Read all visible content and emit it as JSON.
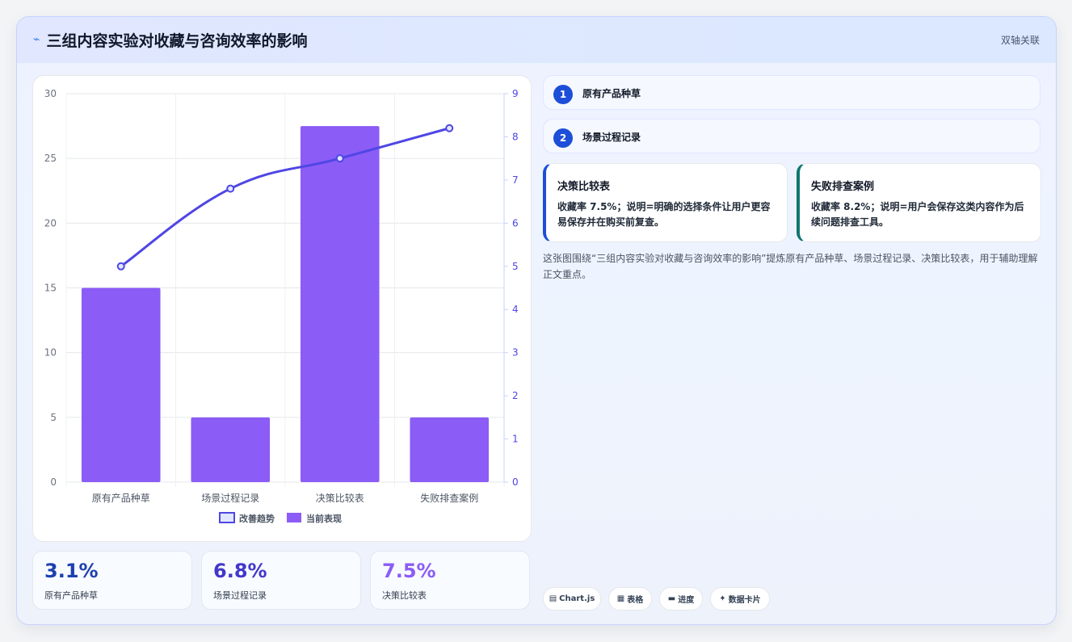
{
  "header": {
    "icon": "sparkline-icon",
    "title": "三组内容实验对收藏与咨询效率的影响",
    "badge": "双轴关联"
  },
  "chart_data": {
    "type": "bar",
    "categories": [
      "原有产品种草",
      "场景过程记录",
      "决策比较表",
      "失败排查案例"
    ],
    "series": [
      {
        "name": "当前表现",
        "type": "bar",
        "axis": "left",
        "values": [
          15,
          5,
          27.5,
          5
        ],
        "color": "#8b5cf6"
      },
      {
        "name": "改善趋势",
        "type": "line",
        "axis": "right",
        "values": [
          5,
          6.8,
          7.5,
          8.2
        ],
        "color": "#4f46e5"
      }
    ],
    "y_left": {
      "range": [
        0,
        30
      ],
      "ticks": [
        "0",
        "5",
        "10",
        "15",
        "20",
        "25",
        "30"
      ]
    },
    "y_right": {
      "range": [
        0,
        9
      ],
      "ticks": [
        "0",
        "1",
        "2",
        "3",
        "4",
        "5",
        "6",
        "7",
        "8",
        "9"
      ]
    },
    "grid": true,
    "legend": "bottom"
  },
  "kpis": [
    {
      "value": "3.1%",
      "label": "原有产品种草",
      "color": "#1e40af"
    },
    {
      "value": "6.8%",
      "label": "场景过程记录",
      "color": "#4338ca"
    },
    {
      "value": "7.5%",
      "label": "决策比较表",
      "color": "#8b5cf6"
    }
  ],
  "steps": [
    {
      "num": "1",
      "label": "原有产品种草"
    },
    {
      "num": "2",
      "label": "场景过程记录"
    }
  ],
  "notes": [
    {
      "title": "决策比较表",
      "body": "收藏率 7.5%；说明=明确的选择条件让用户更容易保存并在购买前复查。",
      "accent": "#1d4ed8"
    },
    {
      "title": "失败排查案例",
      "body": "收藏率 8.2%；说明=用户会保存这类内容作为后续问题排查工具。",
      "accent": "#0f766e"
    }
  ],
  "description": "这张图围绕“三组内容实验对收藏与咨询效率的影响”提炼原有产品种草、场景过程记录、决策比较表，用于辅助理解正文重点。",
  "chips": [
    {
      "icon": "chart-icon",
      "label": "Chart.js"
    },
    {
      "icon": "table-icon",
      "label": "表格"
    },
    {
      "icon": "progress-icon",
      "label": "进度"
    },
    {
      "icon": "sparkle-icon",
      "label": "数据卡片"
    }
  ]
}
